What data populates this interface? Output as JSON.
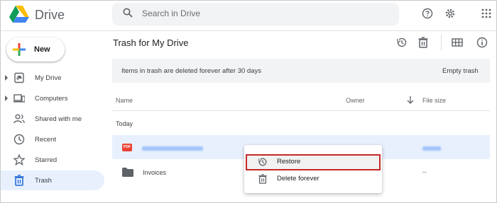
{
  "app": {
    "name": "Drive"
  },
  "search": {
    "placeholder": "Search in Drive"
  },
  "header_icons": [
    "help-icon",
    "settings-icon",
    "apps-grid-icon"
  ],
  "sidebar": {
    "new_label": "New",
    "items": [
      {
        "label": "My Drive",
        "icon": "my-drive-icon",
        "has_caret": true,
        "active": false
      },
      {
        "label": "Computers",
        "icon": "computers-icon",
        "has_caret": true,
        "active": false
      },
      {
        "label": "Shared with me",
        "icon": "shared-icon",
        "has_caret": false,
        "active": false
      },
      {
        "label": "Recent",
        "icon": "clock-icon",
        "has_caret": false,
        "active": false
      },
      {
        "label": "Starred",
        "icon": "star-icon",
        "has_caret": false,
        "active": false
      },
      {
        "label": "Trash",
        "icon": "trash-icon",
        "has_caret": false,
        "active": true
      }
    ]
  },
  "main": {
    "title": "Trash for My Drive",
    "banner": {
      "text": "Items in trash are deleted forever after 30 days",
      "action": "Empty trash"
    },
    "columns": {
      "name": "Name",
      "owner": "Owner",
      "size": "File size"
    },
    "section": "Today",
    "files": [
      {
        "type": "pdf",
        "icon_label": "PDF",
        "name_blurred": true,
        "size_blurred": true,
        "selected": true
      },
      {
        "type": "folder",
        "name": "Invoices",
        "owner": "–",
        "size": "--",
        "selected": false
      }
    ]
  },
  "context_menu": {
    "items": [
      {
        "label": "Restore",
        "icon": "restore-icon",
        "highlighted": true
      },
      {
        "label": "Delete forever",
        "icon": "delete-forever-icon",
        "highlighted": false
      }
    ]
  },
  "colors": {
    "accent": "#1967d2",
    "selection": "#e8f0fe",
    "highlight_border": "#c62828",
    "pdf_red": "#ea4335"
  }
}
